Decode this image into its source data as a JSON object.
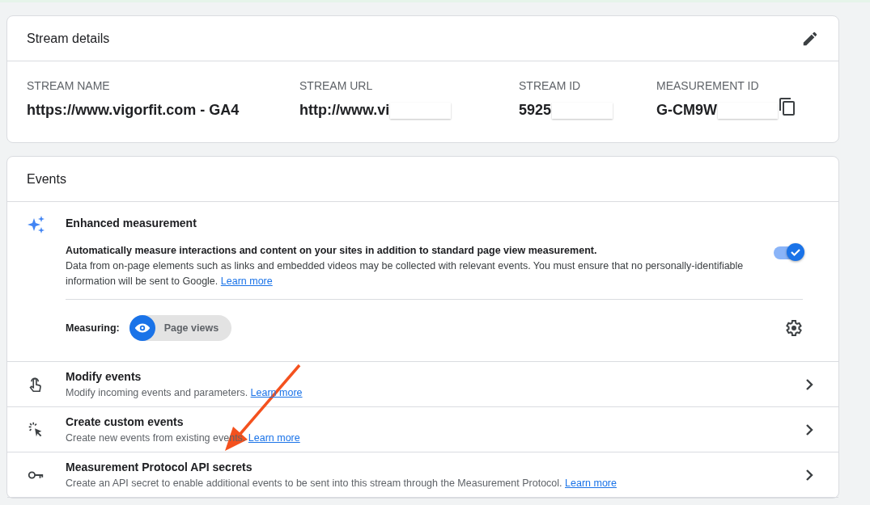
{
  "stream_details": {
    "title": "Stream details",
    "fields": [
      {
        "label": "STREAM NAME",
        "value": "https://www.vigorfit.com - GA4",
        "redacted": false
      },
      {
        "label": "STREAM URL",
        "value": "http://www.vi",
        "redacted": true
      },
      {
        "label": "STREAM ID",
        "value": "5925",
        "redacted": true
      },
      {
        "label": "MEASUREMENT ID",
        "value": "G-CM9W",
        "redacted": true
      }
    ]
  },
  "events": {
    "title": "Events",
    "enhanced_measurement": {
      "title": "Enhanced measurement",
      "summary": "Automatically measure interactions and content on your sites in addition to standard page view measurement.",
      "description": "Data from on-page elements such as links and embedded videos may be collected with relevant events. You must ensure that no personally-identifiable information will be sent to Google.",
      "link": "Learn more",
      "on": true,
      "measuring_label": "Measuring:",
      "measuring": [
        "Page views"
      ]
    },
    "rows": [
      {
        "kind": "touch",
        "title": "Modify events",
        "description": "Modify incoming events and parameters.",
        "link": "Learn more"
      },
      {
        "kind": "click",
        "title": "Create custom events",
        "description": "Create new events from existing events.",
        "link": "Learn more"
      },
      {
        "kind": "key",
        "title": "Measurement Protocol API secrets",
        "description": "Create an API secret to enable additional events to be sent into this stream through the Measurement Protocol.",
        "link": "Learn more"
      }
    ]
  }
}
